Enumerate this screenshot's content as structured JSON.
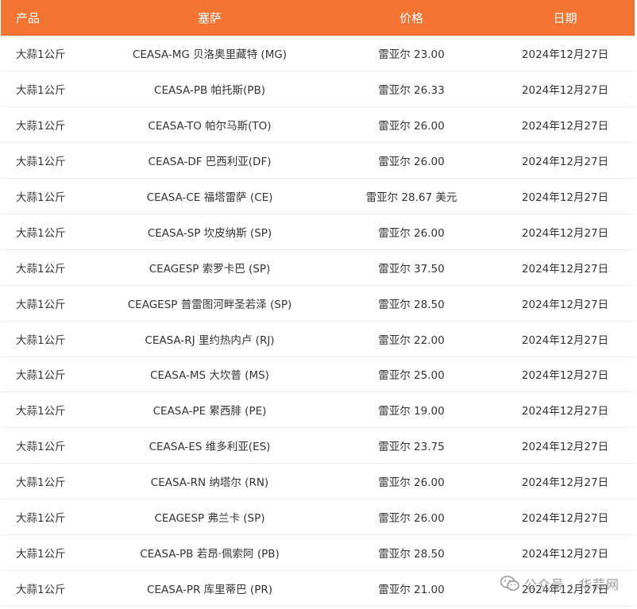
{
  "table": {
    "headers": {
      "product": "产品",
      "market": "塞萨",
      "price": "价格",
      "date": "日期"
    },
    "rows": [
      {
        "product": "大蒜1公斤",
        "market": "CEASA-MG 贝洛奥里藏特 (MG)",
        "price": "雷亚尔 23.00",
        "date": "2024年12月27日"
      },
      {
        "product": "大蒜1公斤",
        "market": "CEASA-PB 帕托斯(PB)",
        "price": "雷亚尔 26.33",
        "date": "2024年12月27日"
      },
      {
        "product": "大蒜1公斤",
        "market": "CEASA-TO 帕尔马斯(TO)",
        "price": "雷亚尔 26.00",
        "date": "2024年12月27日"
      },
      {
        "product": "大蒜1公斤",
        "market": "CEASA-DF 巴西利亚(DF)",
        "price": "雷亚尔 26.00",
        "date": "2024年12月27日"
      },
      {
        "product": "大蒜1公斤",
        "market": "CEASA-CE 福塔雷萨 (CE)",
        "price": "雷亚尔 28.67 美元",
        "date": "2024年12月27日"
      },
      {
        "product": "大蒜1公斤",
        "market": "CEASA-SP 坎皮纳斯 (SP)",
        "price": "雷亚尔 26.00",
        "date": "2024年12月27日"
      },
      {
        "product": "大蒜1公斤",
        "market": "CEAGESP 索罗卡巴 (SP)",
        "price": "雷亚尔 37.50",
        "date": "2024年12月27日"
      },
      {
        "product": "大蒜1公斤",
        "market": "CEAGESP 普雷图河畔圣若泽 (SP)",
        "price": "雷亚尔 28.50",
        "date": "2024年12月27日"
      },
      {
        "product": "大蒜1公斤",
        "market": "CEASA-RJ 里约热内卢 (RJ)",
        "price": "雷亚尔 22.00",
        "date": "2024年12月27日"
      },
      {
        "product": "大蒜1公斤",
        "market": "CEASA-MS 大坎普 (MS)",
        "price": "雷亚尔 25.00",
        "date": "2024年12月27日"
      },
      {
        "product": "大蒜1公斤",
        "market": "CEASA-PE 累西腓 (PE)",
        "price": "雷亚尔 19.00",
        "date": "2024年12月27日"
      },
      {
        "product": "大蒜1公斤",
        "market": "CEASA-ES 维多利亚(ES)",
        "price": "雷亚尔 23.75",
        "date": "2024年12月27日"
      },
      {
        "product": "大蒜1公斤",
        "market": "CEASA-RN 纳塔尔 (RN)",
        "price": "雷亚尔 26.00",
        "date": "2024年12月27日"
      },
      {
        "product": "大蒜1公斤",
        "market": "CEAGESP 弗兰卡 (SP)",
        "price": "雷亚尔 26.00",
        "date": "2024年12月27日"
      },
      {
        "product": "大蒜1公斤",
        "market": "CEASA-PB 若昂·佩索阿 (PB)",
        "price": "雷亚尔 28.50",
        "date": "2024年12月27日"
      },
      {
        "product": "大蒜1公斤",
        "market": "CEASA-PR 库里蒂巴 (PR)",
        "price": "雷亚尔 21.00",
        "date": "2024年12月27日"
      }
    ]
  },
  "watermark": {
    "text": "公众号 · 华蒜网",
    "icon": "wechat-icon"
  },
  "colors": {
    "header_bg": "#f27332",
    "header_text": "#ffffff",
    "row_border": "#ebebeb"
  }
}
